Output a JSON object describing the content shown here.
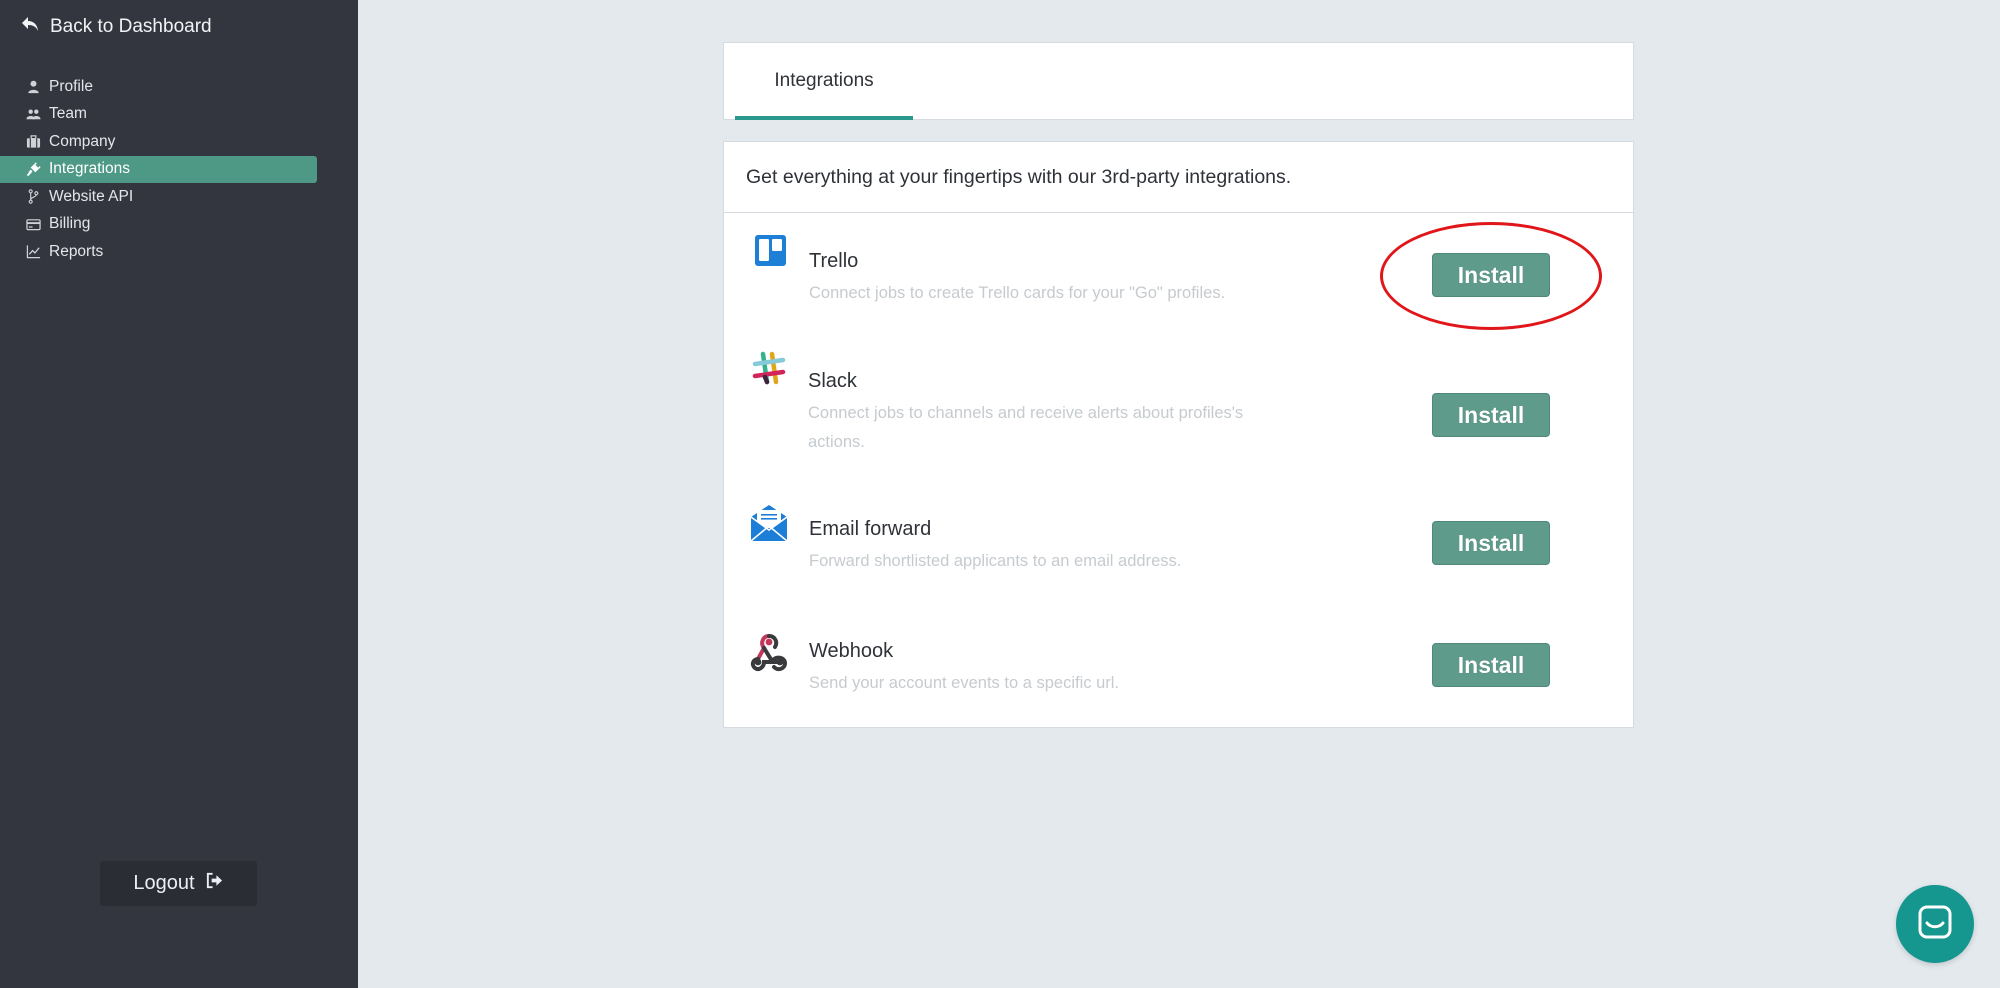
{
  "sidebar": {
    "back_label": "Back to Dashboard",
    "items": [
      {
        "label": "Profile",
        "icon": "user-icon",
        "active": false
      },
      {
        "label": "Team",
        "icon": "users-icon",
        "active": false
      },
      {
        "label": "Company",
        "icon": "briefcase-icon",
        "active": false
      },
      {
        "label": "Integrations",
        "icon": "plug-icon",
        "active": true
      },
      {
        "label": "Website API",
        "icon": "code-branch-icon",
        "active": false
      },
      {
        "label": "Billing",
        "icon": "credit-card-icon",
        "active": false
      },
      {
        "label": "Reports",
        "icon": "line-chart-icon",
        "active": false
      }
    ],
    "logout_label": "Logout"
  },
  "main": {
    "tabs": [
      {
        "label": "Integrations",
        "active": true
      }
    ],
    "intro": "Get everything at your fingertips with our 3rd-party integrations.",
    "integrations": [
      {
        "name": "Trello",
        "description": "Connect jobs to create Trello cards for your \"Go\" profiles.",
        "button": "Install",
        "icon": "trello-icon"
      },
      {
        "name": "Slack",
        "description": "Connect jobs to channels and receive alerts about profiles's actions.",
        "button": "Install",
        "icon": "slack-icon"
      },
      {
        "name": "Email forward",
        "description": "Forward shortlisted applicants to an email address.",
        "button": "Install",
        "icon": "envelope-icon"
      },
      {
        "name": "Webhook",
        "description": "Send your account events to a specific url.",
        "button": "Install",
        "icon": "webhook-icon"
      }
    ]
  },
  "colors": {
    "sidebar_bg": "#33363f",
    "active_nav": "#4d9985",
    "install_button": "#5f9b8b",
    "tab_underline": "#2b9a8e",
    "highlight": "#e0161b",
    "chat_launcher": "#15968e"
  }
}
